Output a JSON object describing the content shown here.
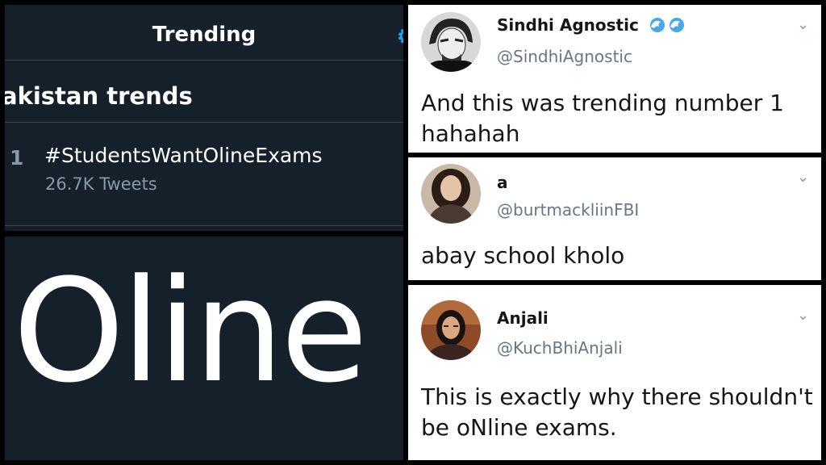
{
  "trending": {
    "title": "Trending",
    "heading": "akistan trends",
    "rank": "1",
    "hashtag": "#StudentsWantOlineExams",
    "tweet_count": "26.7K Tweets"
  },
  "zoom": {
    "text": "Oline"
  },
  "tweets": [
    {
      "name": "Sindhi Agnostic",
      "handle": "@SindhiAgnostic",
      "text": "And this was trending number 1 hahahah",
      "badge_icon": "wave-emoji-icon"
    },
    {
      "name": "a",
      "handle": "@burtmackliinFBI",
      "text": "abay school kholo"
    },
    {
      "name": "Anjali",
      "handle": "@KuchBhiAnjali",
      "text": "This is exactly why there shouldn't be oNline exams."
    }
  ],
  "colors": {
    "dark_bg": "#15202b",
    "twitter_blue": "#1da1f2",
    "muted": "#8899a6"
  }
}
